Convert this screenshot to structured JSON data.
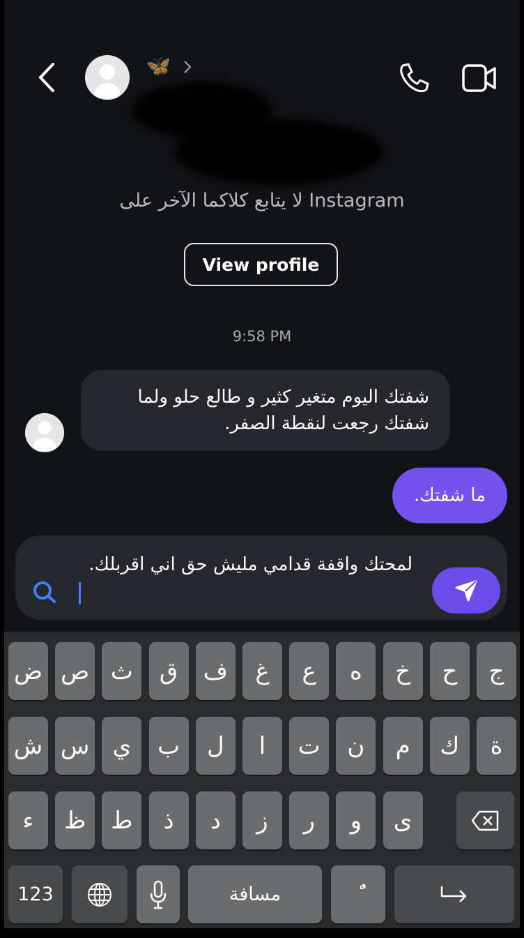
{
  "header": {
    "badge_emoji": "🦋",
    "subtitle": "لا يتابع كلاكما الآخر على Instagram",
    "view_profile": "View profile"
  },
  "chat": {
    "timestamp": "9:58 PM",
    "messages": [
      {
        "from": "them",
        "text": "شفتك اليوم متغير كثير و طالع حلو ولما شفتك رجعت لنقطة الصفر."
      },
      {
        "from": "me",
        "text": "ما شفتك."
      }
    ]
  },
  "composer": {
    "value": "لمحتك واقفة قدامي مليش حق اني اقربلك."
  },
  "keyboard": {
    "row1": [
      "ض",
      "ص",
      "ث",
      "ق",
      "ف",
      "غ",
      "ع",
      "ه",
      "خ",
      "ح",
      "ج"
    ],
    "row2": [
      "ش",
      "س",
      "ي",
      "ب",
      "ل",
      "ا",
      "ت",
      "ن",
      "م",
      "ك",
      "ة"
    ],
    "row3": [
      "ء",
      "ظ",
      "ط",
      "ذ",
      "د",
      "ز",
      "ر",
      "و",
      "ى"
    ],
    "numbers": "123",
    "space": "مسافة",
    "diacritic": "ًٌ"
  },
  "colors": {
    "background": "#121317",
    "accent": "#7352ee",
    "bubble_in": "#26272d",
    "butterfly": "#3fb4f5"
  }
}
